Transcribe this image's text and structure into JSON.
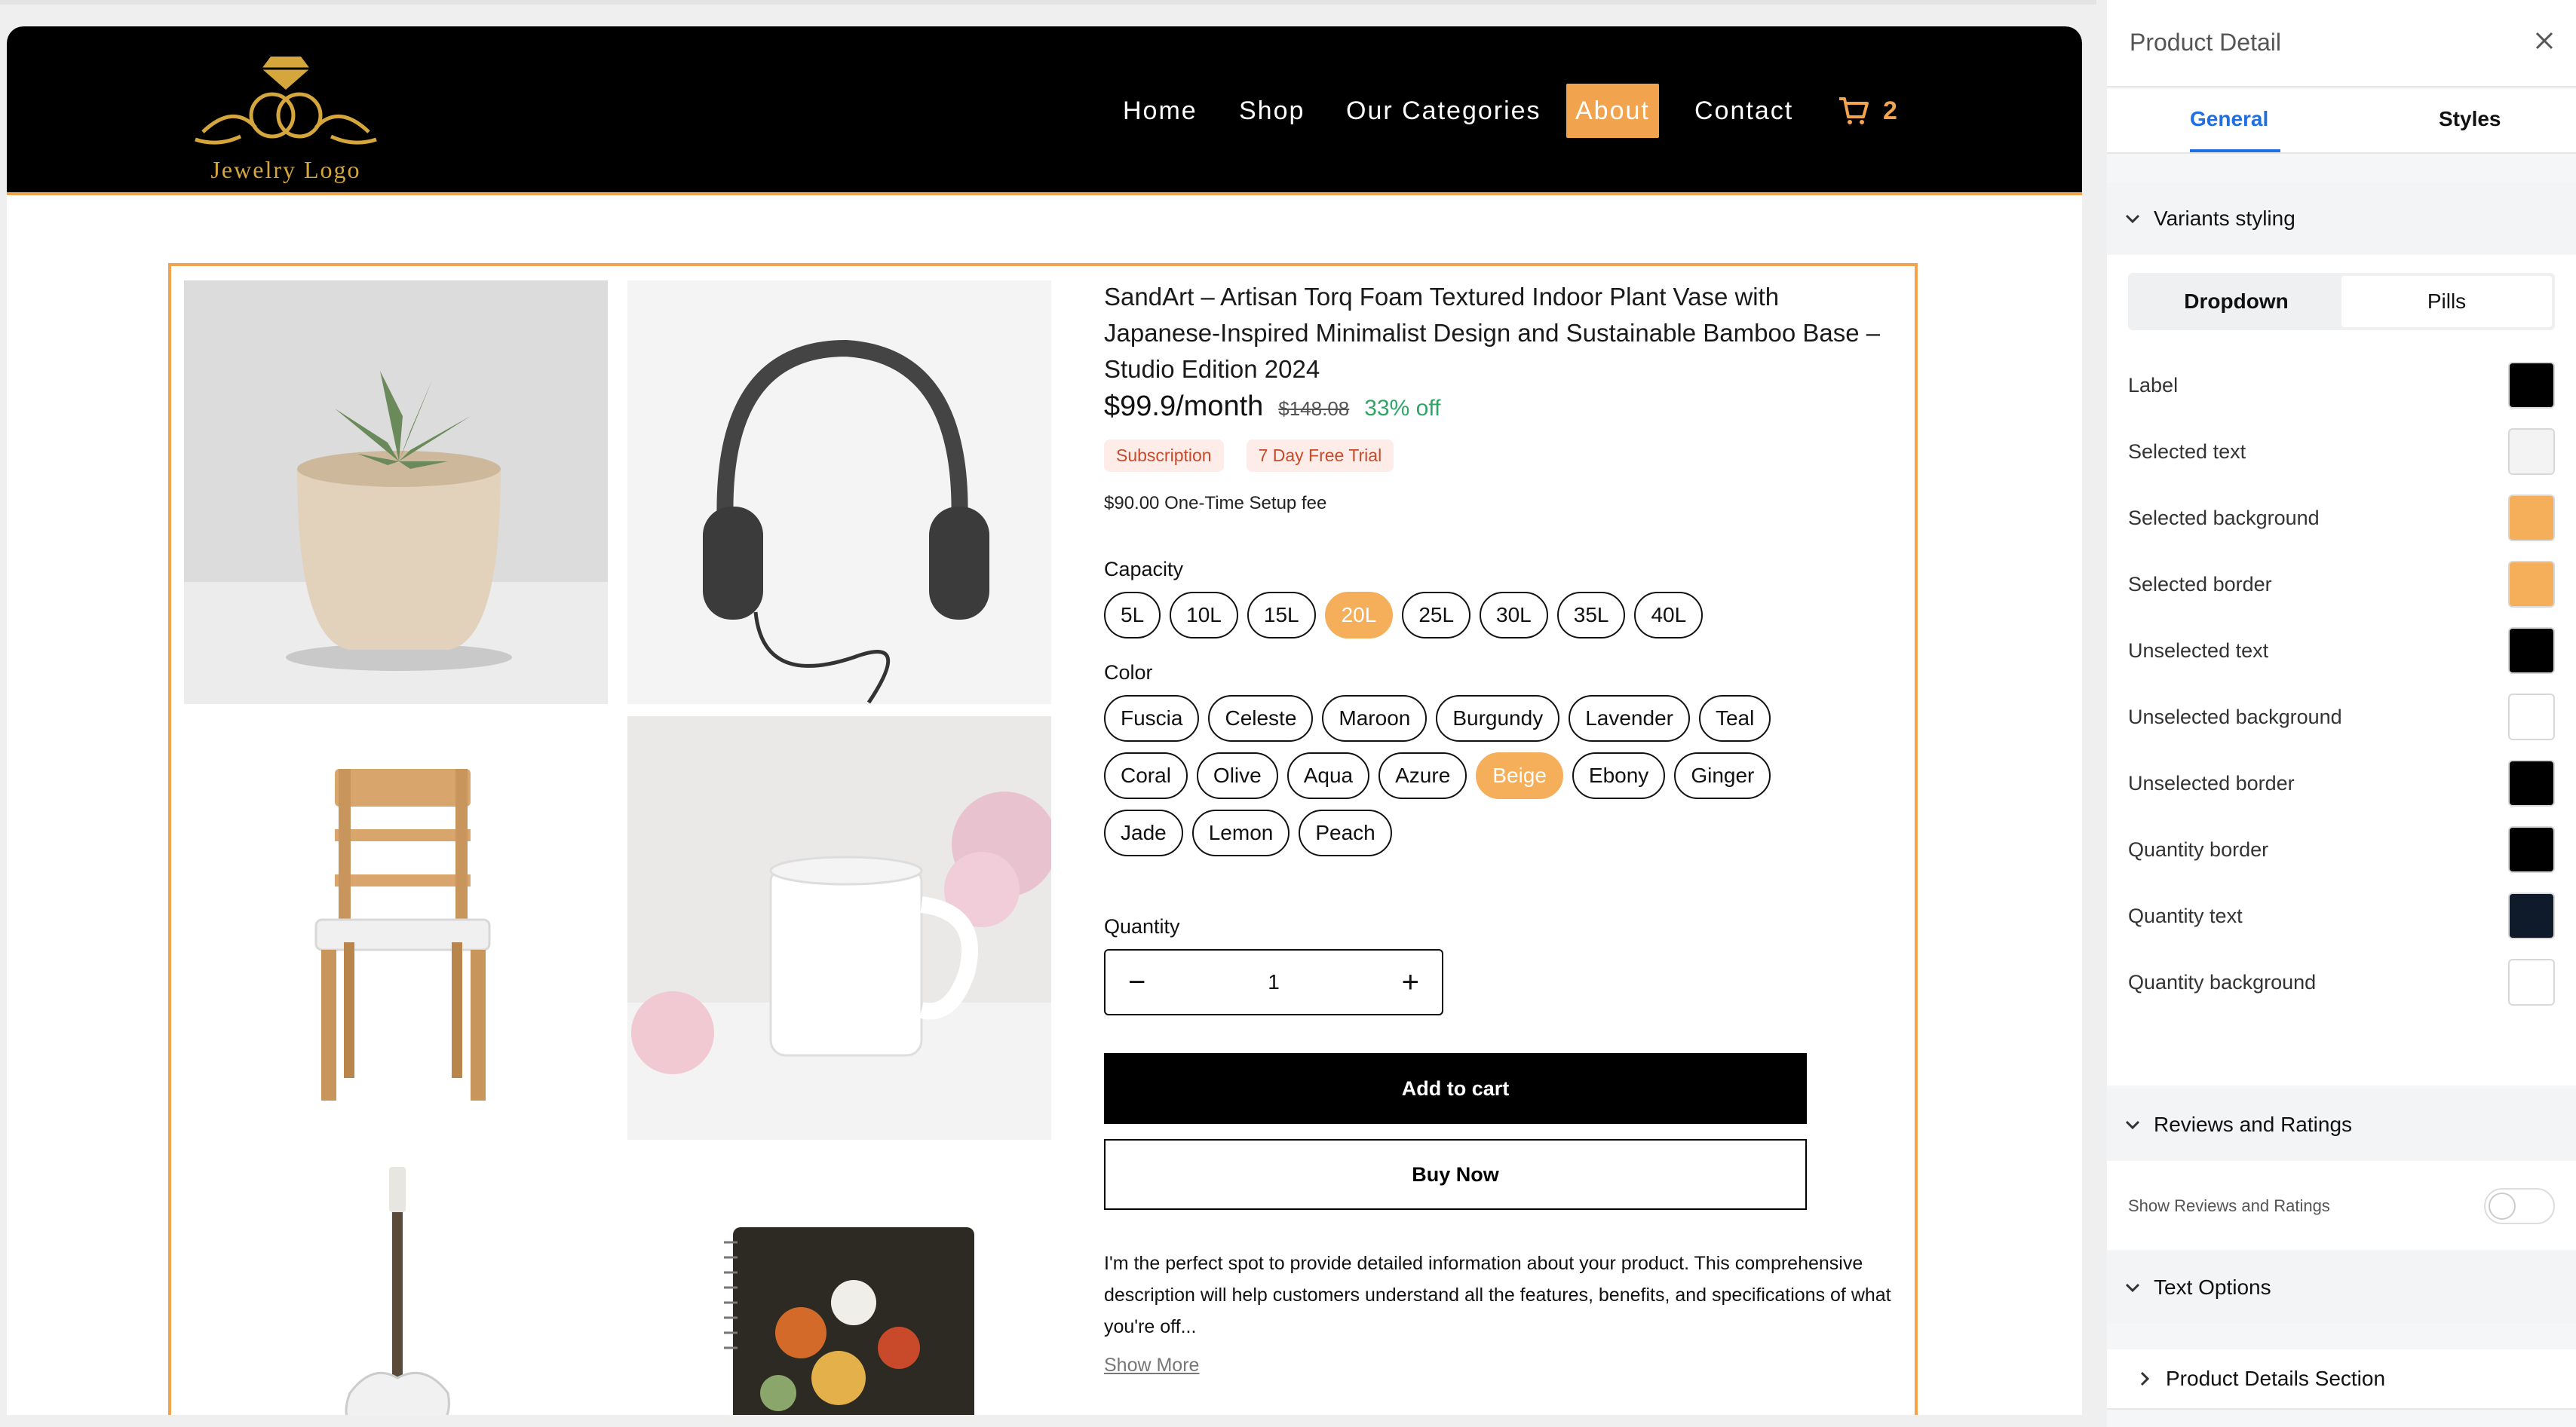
{
  "brand": {
    "logo_text": "Jewelry Logo",
    "accent": "#f2a34d"
  },
  "nav": {
    "items": [
      "Home",
      "Shop",
      "Our Categories",
      "About",
      "Contact"
    ],
    "active": "About",
    "cart_count": "2"
  },
  "product": {
    "title": "SandArt – Artisan Torq Foam Textured Indoor Plant Vase with Japanese-Inspired Minimalist Design and Sustainable Bamboo Base – Studio Edition 2024",
    "price": "$99.9/month",
    "old_price": "$148.08",
    "discount": "33% off",
    "badges": [
      "Subscription",
      "7 Day Free Trial"
    ],
    "setup_fee": "$90.00 One-Time Setup fee",
    "capacity_label": "Capacity",
    "capacity_options": [
      "5L",
      "10L",
      "15L",
      "20L",
      "25L",
      "30L",
      "35L",
      "40L"
    ],
    "capacity_selected": "20L",
    "color_label": "Color",
    "color_options": [
      "Fuscia",
      "Celeste",
      "Maroon",
      "Burgundy",
      "Lavender",
      "Teal",
      "Coral",
      "Olive",
      "Aqua",
      "Azure",
      "Beige",
      "Ebony",
      "Ginger",
      "Jade",
      "Lemon",
      "Peach"
    ],
    "color_selected": "Beige",
    "quantity_label": "Quantity",
    "quantity": "1",
    "quantity_minus": "−",
    "quantity_plus": "+",
    "add_to_cart": "Add to cart",
    "buy_now": "Buy Now",
    "description": "I'm the perfect spot to provide detailed information about your product. This comprehensive description will help customers understand all the features, benefits, and specifications of what you're off...",
    "show_more": "Show More",
    "images": [
      "plant-pot",
      "headphones",
      "chair",
      "mug-with-flowers",
      "guitar",
      "floral-notebook"
    ]
  },
  "panel": {
    "title": "Product Detail",
    "close_icon": "close-icon",
    "tabs": [
      "General",
      "Styles"
    ],
    "active_tab": "General",
    "variants_section": "Variants styling",
    "variant_modes": [
      "Dropdown",
      "Pills"
    ],
    "variant_mode_selected": "Dropdown",
    "style_rows": [
      {
        "label": "Label",
        "color": "#000000"
      },
      {
        "label": "Selected text",
        "color": "#f3f3f3"
      },
      {
        "label": "Selected background",
        "color": "#f5ae5a"
      },
      {
        "label": "Selected border",
        "color": "#f5ae5a"
      },
      {
        "label": "Unselected text",
        "color": "#000000"
      },
      {
        "label": "Unselected background",
        "color": "#ffffff"
      },
      {
        "label": "Unselected border",
        "color": "#000000"
      },
      {
        "label": "Quantity border",
        "color": "#000000"
      },
      {
        "label": "Quantity text",
        "color": "#0f1a2a"
      },
      {
        "label": "Quantity background",
        "color": "#ffffff"
      }
    ],
    "reviews_section": "Reviews and Ratings",
    "reviews_toggle_label": "Show Reviews and Ratings",
    "reviews_toggle_on": false,
    "text_options_section": "Text Options",
    "product_details_section": "Product Details Section"
  }
}
